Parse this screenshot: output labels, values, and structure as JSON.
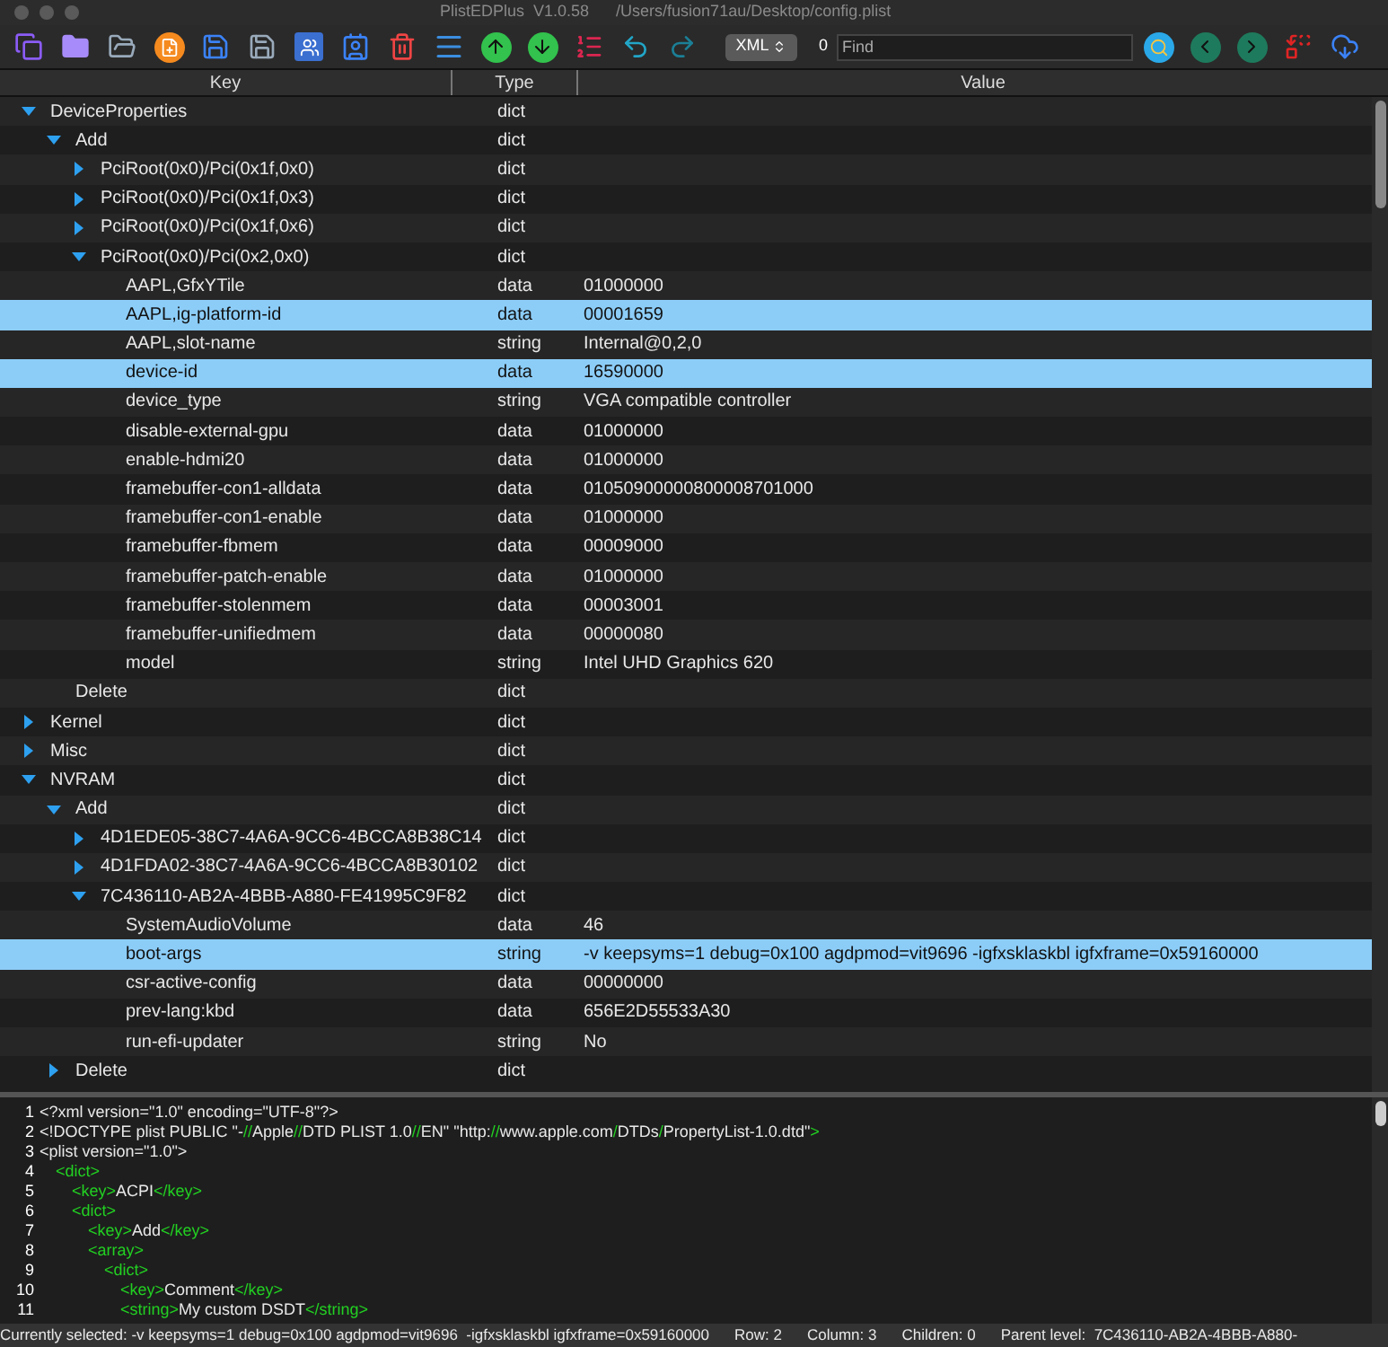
{
  "window": {
    "title": "PlistEDPlus  V1.0.58      /Users/fusion71au/Desktop/config.plist"
  },
  "toolbar": {
    "format": "XML",
    "find_count": "0",
    "find": {
      "placeholder": "Find"
    }
  },
  "table": {
    "columns": [
      "Key",
      "Type",
      "Value"
    ],
    "rows": [
      {
        "key": "DeviceProperties",
        "type": "dict",
        "expanded": true,
        "selected": false,
        "children": [
          {
            "key": "Add",
            "type": "dict",
            "expanded": true,
            "selected": false,
            "children": [
              {
                "key": "PciRoot(0x0)/Pci(0x1f,0x0)",
                "type": "dict",
                "expanded": false,
                "selected": false
              },
              {
                "key": "PciRoot(0x0)/Pci(0x1f,0x3)",
                "type": "dict",
                "expanded": false,
                "selected": false
              },
              {
                "key": "PciRoot(0x0)/Pci(0x1f,0x6)",
                "type": "dict",
                "expanded": false,
                "selected": false
              },
              {
                "key": "PciRoot(0x0)/Pci(0x2,0x0)",
                "type": "dict",
                "expanded": true,
                "selected": false,
                "children": [
                  {
                    "key": "AAPL,GfxYTile",
                    "type": "data",
                    "value": "01000000",
                    "selected": false
                  },
                  {
                    "key": "AAPL,ig-platform-id",
                    "type": "data",
                    "value": "00001659",
                    "selected": true
                  },
                  {
                    "key": "AAPL,slot-name",
                    "type": "string",
                    "value": "Internal@0,2,0",
                    "selected": false
                  },
                  {
                    "key": "device-id",
                    "type": "data",
                    "value": "16590000",
                    "selected": true
                  },
                  {
                    "key": "device_type",
                    "type": "string",
                    "value": "VGA compatible controller",
                    "selected": false
                  },
                  {
                    "key": "disable-external-gpu",
                    "type": "data",
                    "value": "01000000",
                    "selected": false
                  },
                  {
                    "key": "enable-hdmi20",
                    "type": "data",
                    "value": "01000000",
                    "selected": false
                  },
                  {
                    "key": "framebuffer-con1-alldata",
                    "type": "data",
                    "value": "01050900000800008701000",
                    "selected": false
                  },
                  {
                    "key": "framebuffer-con1-enable",
                    "type": "data",
                    "value": "01000000",
                    "selected": false
                  },
                  {
                    "key": "framebuffer-fbmem",
                    "type": "data",
                    "value": "00009000",
                    "selected": false
                  },
                  {
                    "key": "framebuffer-patch-enable",
                    "type": "data",
                    "value": "01000000",
                    "selected": false
                  },
                  {
                    "key": "framebuffer-stolenmem",
                    "type": "data",
                    "value": "00003001",
                    "selected": false
                  },
                  {
                    "key": "framebuffer-unifiedmem",
                    "type": "data",
                    "value": "00000080",
                    "selected": false
                  },
                  {
                    "key": "model",
                    "type": "string",
                    "value": "Intel UHD Graphics 620",
                    "selected": false
                  }
                ]
              }
            ]
          },
          {
            "key": "Delete",
            "type": "dict",
            "selected": false
          }
        ]
      },
      {
        "key": "Kernel",
        "type": "dict",
        "expanded": false,
        "selected": false
      },
      {
        "key": "Misc",
        "type": "dict",
        "expanded": false,
        "selected": false
      },
      {
        "key": "NVRAM",
        "type": "dict",
        "expanded": true,
        "selected": false,
        "children": [
          {
            "key": "Add",
            "type": "dict",
            "expanded": true,
            "selected": false,
            "children": [
              {
                "key": "4D1EDE05-38C7-4A6A-9CC6-4BCCA8B38C14",
                "type": "dict",
                "expanded": false,
                "selected": false
              },
              {
                "key": "4D1FDA02-38C7-4A6A-9CC6-4BCCA8B30102",
                "type": "dict",
                "expanded": false,
                "selected": false
              },
              {
                "key": "7C436110-AB2A-4BBB-A880-FE41995C9F82",
                "type": "dict",
                "expanded": true,
                "selected": false,
                "children": [
                  {
                    "key": "SystemAudioVolume",
                    "type": "data",
                    "value": "46",
                    "selected": false
                  },
                  {
                    "key": "boot-args",
                    "type": "string",
                    "value": "-v keepsyms=1 debug=0x100 agdpmod=vit9696  -igfxsklaskbl igfxframe=0x59160000",
                    "selected": true
                  },
                  {
                    "key": "csr-active-config",
                    "type": "data",
                    "value": "00000000",
                    "selected": false
                  },
                  {
                    "key": "prev-lang:kbd",
                    "type": "data",
                    "value": "656E2D55533A30",
                    "selected": false
                  },
                  {
                    "key": "run-efi-updater",
                    "type": "string",
                    "value": "No",
                    "selected": false
                  }
                ]
              }
            ]
          },
          {
            "key": "Delete",
            "type": "dict",
            "expanded": false,
            "selected": false
          }
        ]
      }
    ]
  },
  "editor": {
    "lines": [
      {
        "number": "1",
        "segments": [
          {
            "kind": "text",
            "text": "<?xml version=\"1.0\" encoding=\"UTF-8\"?>"
          }
        ]
      },
      {
        "number": "2",
        "segments": [
          {
            "kind": "text",
            "text": "<!DOCTYPE plist PUBLIC \"-"
          },
          {
            "kind": "tag",
            "text": "//"
          },
          {
            "kind": "text",
            "text": "Apple"
          },
          {
            "kind": "tag",
            "text": "//"
          },
          {
            "kind": "text",
            "text": "DTD PLIST 1.0"
          },
          {
            "kind": "tag",
            "text": "//"
          },
          {
            "kind": "text",
            "text": "EN\" \"http:"
          },
          {
            "kind": "tag",
            "text": "//"
          },
          {
            "kind": "text",
            "text": "www.apple.com"
          },
          {
            "kind": "tag",
            "text": "/"
          },
          {
            "kind": "text",
            "text": "DTDs"
          },
          {
            "kind": "tag",
            "text": "/"
          },
          {
            "kind": "text",
            "text": "PropertyList-1.0.dtd\""
          },
          {
            "kind": "tag",
            "text": ">"
          }
        ]
      },
      {
        "number": "3",
        "segments": [
          {
            "kind": "text",
            "text": "<plist version=\"1.0\">"
          }
        ],
        "children": [
          {
            "number": "4",
            "segments": [
              {
                "kind": "tag",
                "text": "<dict>"
              }
            ],
            "children": [
              {
                "number": "5",
                "segments": [
                  {
                    "kind": "tag",
                    "text": "<key>"
                  },
                  {
                    "kind": "text",
                    "text": "ACPI"
                  },
                  {
                    "kind": "tag",
                    "text": "</key>"
                  }
                ]
              },
              {
                "number": "6",
                "segments": [
                  {
                    "kind": "tag",
                    "text": "<dict>"
                  }
                ],
                "children": [
                  {
                    "number": "7",
                    "segments": [
                      {
                        "kind": "tag",
                        "text": "<key>"
                      },
                      {
                        "kind": "text",
                        "text": "Add"
                      },
                      {
                        "kind": "tag",
                        "text": "</key>"
                      }
                    ]
                  },
                  {
                    "number": "8",
                    "segments": [
                      {
                        "kind": "tag",
                        "text": "<array>"
                      }
                    ],
                    "children": [
                      {
                        "number": "9",
                        "segments": [
                          {
                            "kind": "tag",
                            "text": "<dict>"
                          }
                        ],
                        "children": [
                          {
                            "number": "10",
                            "segments": [
                              {
                                "kind": "tag",
                                "text": "<key>"
                              },
                              {
                                "kind": "text",
                                "text": "Comment"
                              },
                              {
                                "kind": "tag",
                                "text": "</key>"
                              }
                            ]
                          },
                          {
                            "number": "11",
                            "segments": [
                              {
                                "kind": "tag",
                                "text": "<string>"
                              },
                              {
                                "kind": "text",
                                "text": "My custom DSDT"
                              },
                              {
                                "kind": "tag",
                                "text": "</string>"
                              }
                            ]
                          }
                        ]
                      }
                    ]
                  }
                ]
              }
            ]
          }
        ]
      }
    ]
  },
  "status_bar": [
    "Currently selected: -v keepsyms=1 debug=0x100 agdpmod=vit9696  -igfxsklaskbl igfxframe=0x59160000",
    "Row: 2",
    "Column: 3",
    "Children: 0",
    "Parent level:  7C436110-AB2A-4BBB-A880-"
  ]
}
